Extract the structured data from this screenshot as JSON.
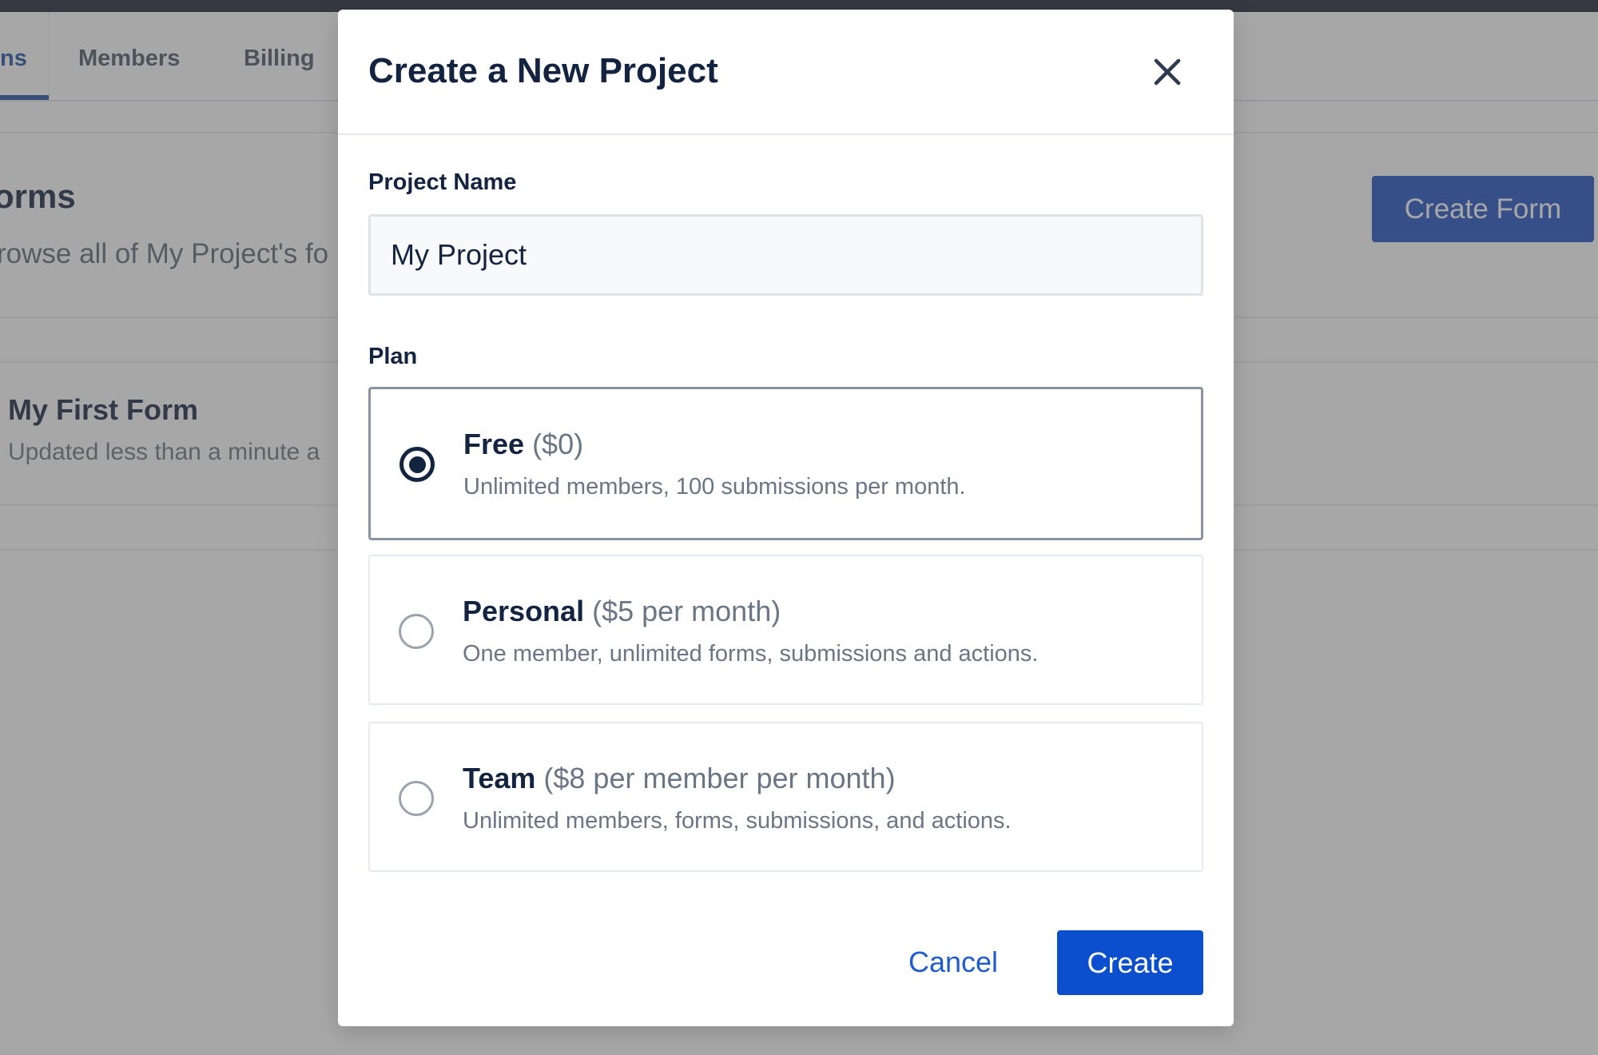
{
  "background": {
    "tabs": [
      {
        "label": "ns",
        "active": true
      },
      {
        "label": "Members",
        "active": false
      },
      {
        "label": "Billing",
        "active": false
      }
    ],
    "page_title": "orms",
    "page_subtitle": "rowse all of My Project's fo",
    "create_form_label": "Create Form",
    "form_item": {
      "title": "My First Form",
      "updated": "Updated less than a minute a"
    }
  },
  "modal": {
    "title": "Create a New Project",
    "project_name_label": "Project Name",
    "project_name_value": "My Project",
    "plan_label": "Plan",
    "plans": [
      {
        "name": "Free",
        "price": "($0)",
        "description": "Unlimited members, 100 submissions per month.",
        "selected": true
      },
      {
        "name": "Personal",
        "price": "($5 per month)",
        "description": "One member, unlimited forms, submissions and actions.",
        "selected": false
      },
      {
        "name": "Team",
        "price": "($8 per member per month)",
        "description": "Unlimited members, forms, submissions, and actions.",
        "selected": false
      }
    ],
    "cancel_label": "Cancel",
    "create_label": "Create"
  },
  "colors": {
    "accent": "#0b4fcf",
    "title_text": "#142340",
    "muted_text": "#6b7684",
    "overlay": "rgba(80,80,80,0.5)"
  },
  "icons": {
    "close": "close-icon"
  }
}
